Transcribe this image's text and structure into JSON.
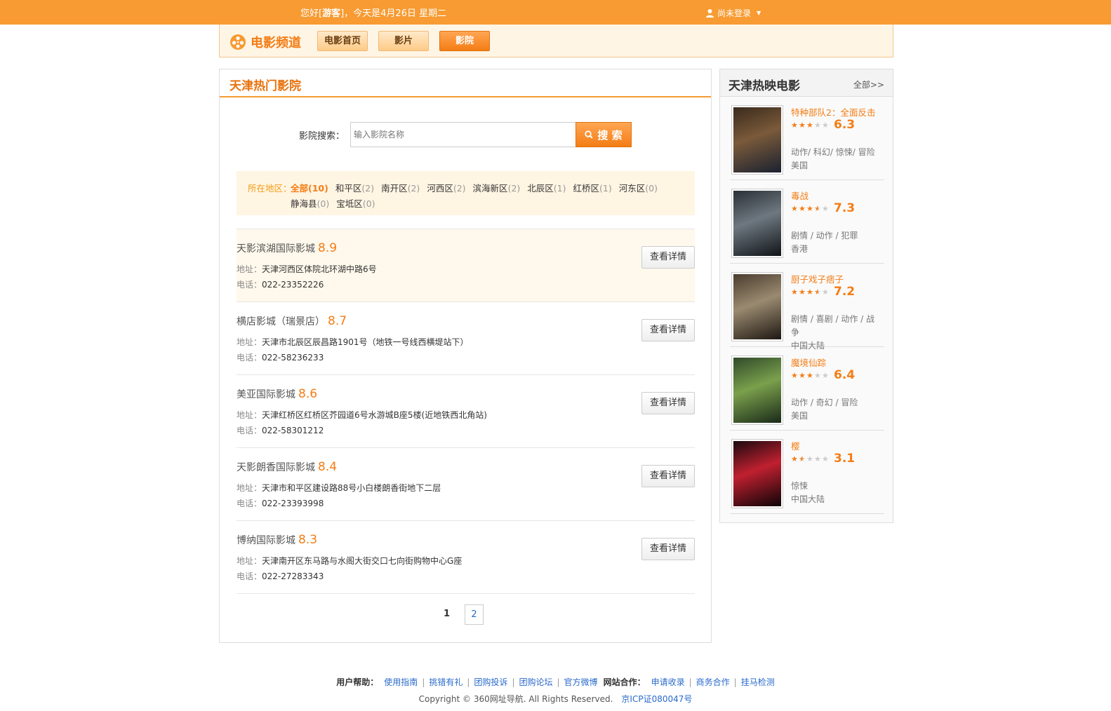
{
  "topbar": {
    "greeting_prefix": "您好[",
    "guest": "游客",
    "greeting_suffix": "]，今天是4月26日 星期二",
    "login": "尚未登录"
  },
  "nav": {
    "logo": "电影频道",
    "items": [
      "电影首页",
      "影片",
      "影院"
    ],
    "active_index": 2
  },
  "main": {
    "title": "天津热门影院",
    "search_label": "影院搜索：",
    "search_placeholder": "输入影院名称",
    "search_button": "搜 索",
    "filter_label": "所在地区：",
    "filters_row1": [
      {
        "name": "全部",
        "count": "(10)",
        "active": true
      },
      {
        "name": "和平区",
        "count": "(2)"
      },
      {
        "name": "南开区",
        "count": "(2)"
      },
      {
        "name": "河西区",
        "count": "(2)"
      },
      {
        "name": "滨海新区",
        "count": "(2)"
      },
      {
        "name": "北辰区",
        "count": "(1)"
      },
      {
        "name": "红桥区",
        "count": "(1)"
      },
      {
        "name": "河东区",
        "count": "(0)"
      }
    ],
    "filters_row2": [
      {
        "name": "静海县",
        "count": "(0)"
      },
      {
        "name": "宝坻区",
        "count": "(0)"
      }
    ],
    "address_key": "地址：",
    "phone_key": "电话：",
    "detail_button": "查看详情",
    "cinemas": [
      {
        "name": "天影滨湖国际影城",
        "score": "8.9",
        "address": "天津河西区体院北环湖中路6号",
        "phone": "022-23352226"
      },
      {
        "name": "横店影城（瑞景店）",
        "score": "8.7",
        "address": "天津市北辰区辰昌路1901号（地铁一号线西横堤站下）",
        "phone": "022-58236233"
      },
      {
        "name": "美亚国际影城",
        "score": "8.6",
        "address": "天津红桥区红桥区芥园道6号水游城B座5楼(近地铁西北角站)",
        "phone": "022-58301212"
      },
      {
        "name": "天影朗香国际影城",
        "score": "8.4",
        "address": "天津市和平区建设路88号小白楼朗香街地下二层",
        "phone": "022-23393998"
      },
      {
        "name": "博纳国际影城",
        "score": "8.3",
        "address": "天津南开区东马路与水阁大街交口七向街购物中心G座",
        "phone": "022-27283343"
      }
    ],
    "pages": [
      "1",
      "2"
    ]
  },
  "side": {
    "title": "天津热映电影",
    "more": "全部>>",
    "movies": [
      {
        "title": "特种部队2：全面反击",
        "stars": 3,
        "score": "6.3",
        "genre": "动作/ 科幻/ 惊悚/ 冒险",
        "region": "美国",
        "colors": [
          "#3a2a1c",
          "#7a5a3a",
          "#1a2130"
        ]
      },
      {
        "title": "毒战",
        "stars": 3.5,
        "score": "7.3",
        "genre": "剧情 / 动作 / 犯罪",
        "region": "香港",
        "colors": [
          "#2b3036",
          "#6e7880",
          "#101418"
        ]
      },
      {
        "title": "厨子戏子痞子",
        "stars": 3.5,
        "score": "7.2",
        "genre": "剧情 / 喜剧 / 动作 / 战争",
        "region": "中国大陆",
        "colors": [
          "#4a3c2e",
          "#9a8a70",
          "#1e1812"
        ]
      },
      {
        "title": "魔境仙踪",
        "stars": 3,
        "score": "6.4",
        "genre": "动作 / 奇幻 / 冒险",
        "region": "美国",
        "colors": [
          "#2f4a2a",
          "#7aa04c",
          "#1a2a18"
        ]
      },
      {
        "title": "樱",
        "stars": 1.5,
        "score": "3.1",
        "genre": "惊悚",
        "region": "中国大陆",
        "colors": [
          "#1a0a0e",
          "#c02030",
          "#0c0406"
        ]
      }
    ]
  },
  "footer": {
    "help_label": "用户帮助：",
    "help_links": [
      "使用指南",
      "挑错有礼",
      "团购投诉",
      "团购论坛",
      "官方微博"
    ],
    "coop_label": "网站合作：",
    "coop_links": [
      "申请收录",
      "商务合作",
      "挂马检测"
    ],
    "copyright": "Copyright © 360网址导航. All Rights Reserved.",
    "icp": "京ICP证080047号"
  }
}
